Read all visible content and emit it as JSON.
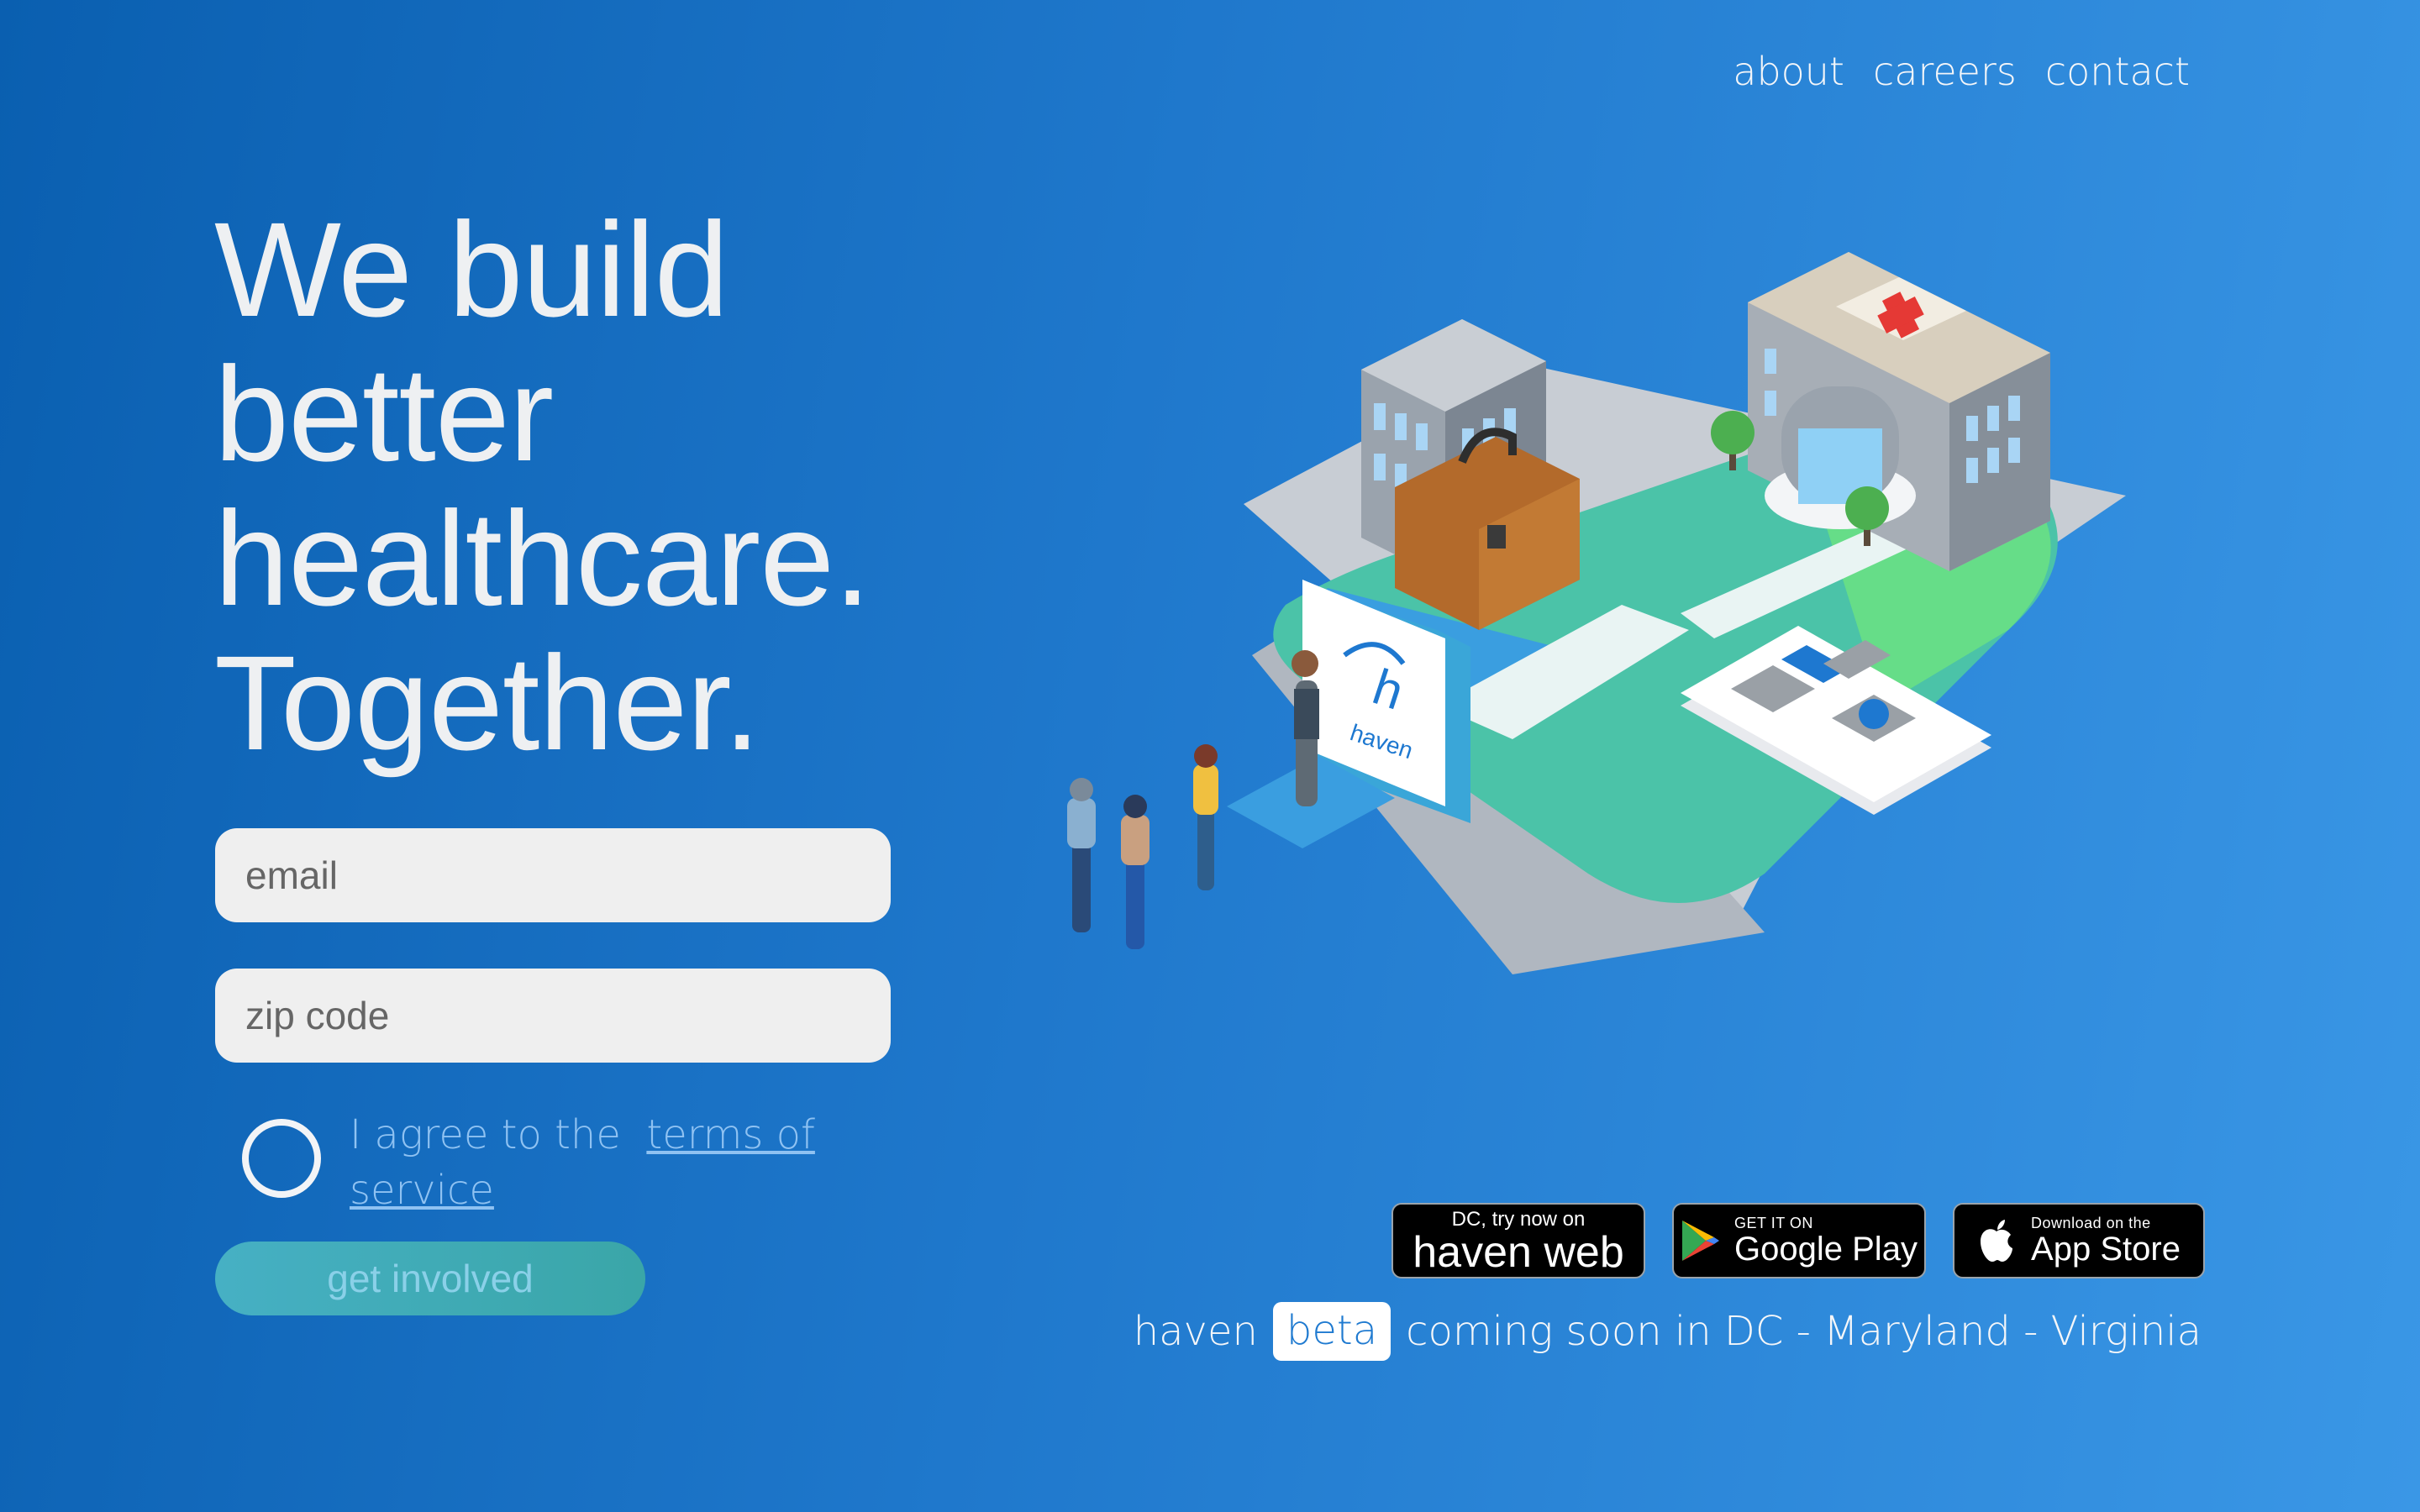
{
  "nav": {
    "about": "about",
    "careers": "careers",
    "contact": "contact"
  },
  "hero": {
    "line1": "We build",
    "line2": "better",
    "line3": "healthcare.",
    "line4": "Together."
  },
  "form": {
    "email_placeholder": "email",
    "zip_placeholder": "zip code",
    "agree_prefix": "I agree to the",
    "terms_link": "terms of service",
    "submit_label": "get involved"
  },
  "illustration": {
    "card_letter": "h",
    "card_brand": "haven"
  },
  "badges": {
    "web_small": "DC, try now on",
    "web_large": "haven web",
    "gp_small": "GET IT ON",
    "gp_large": "Google Play",
    "as_small": "Download on the",
    "as_large": "App Store"
  },
  "tagline": {
    "brand": "haven",
    "beta": "beta",
    "text": "coming soon in DC - Maryland - Virginia"
  },
  "colors": {
    "bg_start": "#0a5fb0",
    "bg_end": "#3a97e6",
    "cta": "#3aa6a8",
    "beta_text": "#1f7ad0"
  }
}
